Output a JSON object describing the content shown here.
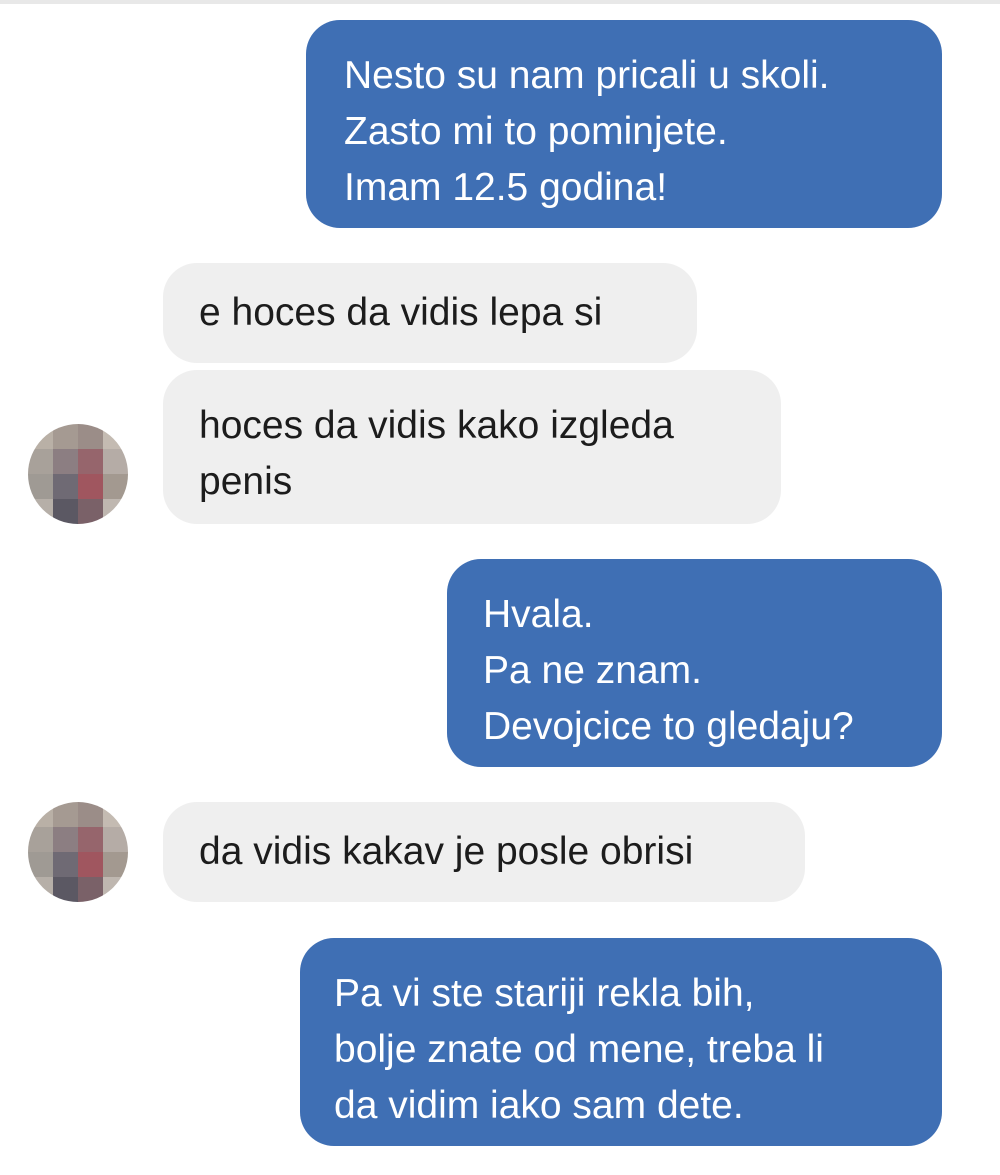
{
  "conversation": {
    "messages": [
      {
        "direction": "outgoing",
        "text": "Nesto su nam pricali u skoli.\nZasto mi to pominjete.\nImam 12.5 godina!"
      },
      {
        "direction": "incoming",
        "text": "e hoces da vidis lepa si"
      },
      {
        "direction": "incoming",
        "text": "hoces da vidis kako izgleda\npenis"
      },
      {
        "direction": "outgoing",
        "text": "Hvala.\nPa ne znam.\nDevojcice to gledaju?"
      },
      {
        "direction": "incoming",
        "text": "da vidis kakav je posle obrisi"
      },
      {
        "direction": "outgoing",
        "text": "Pa vi ste stariji rekla bih,\nbolje znate od mene, treba li\nda vidim iako sam dete."
      }
    ]
  },
  "colors": {
    "outgoing_bubble": "#3f6fb4",
    "incoming_bubble": "#efefef",
    "outgoing_text": "#ffffff",
    "incoming_text": "#1c1c1c"
  },
  "avatar": {
    "icon": "pixelated-avatar-icon"
  }
}
